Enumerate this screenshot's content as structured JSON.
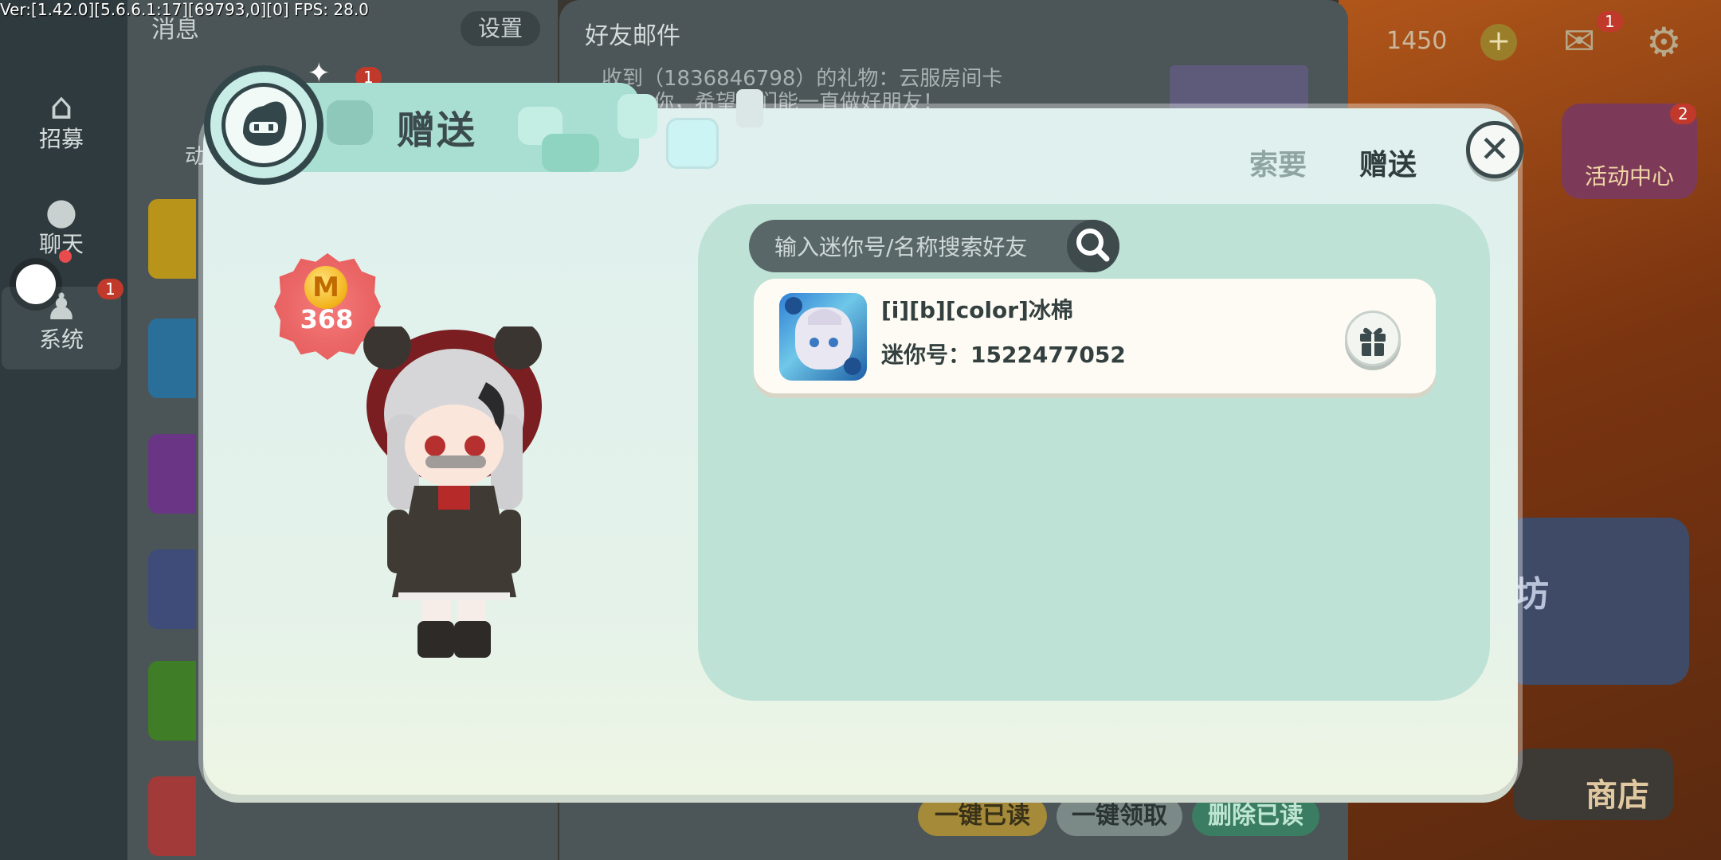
{
  "debug": "Ver:[1.42.0][5.6.6.1:17][69793,0][0] FPS: 28.0",
  "background": {
    "nav": [
      {
        "icon": "home-icon",
        "label": "招募"
      },
      {
        "icon": "chat-icon",
        "label": "聊天"
      },
      {
        "icon": "bell-icon",
        "label": "系统",
        "badge": "1"
      }
    ],
    "msg_title": "消息",
    "settings_label": "设置",
    "msg_badge": "1",
    "msg_tab_label": "动",
    "mail_title": "好友邮件",
    "mail_lines": [
      "收到（1836846798）的礼物：云服房间卡",
      "你，希望我们能一直做好朋友！"
    ],
    "bottom_buttons": [
      "一键已读",
      "一键领取",
      "删除已读"
    ],
    "coin_count": "1450",
    "mail_badge": "1",
    "activity_label": "活动中心",
    "activity_badge": "2",
    "shop_label": "商店",
    "side_partial": "坊"
  },
  "dialog": {
    "title": "赠送",
    "tabs": {
      "request": "索要",
      "gift": "赠送"
    },
    "close_label": "✕",
    "coin_balance": "368",
    "coin_symbol": "M",
    "search": {
      "placeholder": "输入迷你号/名称搜索好友",
      "value": ""
    },
    "friends": [
      {
        "name": "[i][b][color]冰棉",
        "id_label": "迷你号：1522477052"
      }
    ]
  },
  "colors": {
    "dialog_bg": "#dff0ee",
    "panel_bg": "#bfe2d6",
    "title_tab": "#a9dfd3",
    "dark_text": "#2f3d3f"
  }
}
